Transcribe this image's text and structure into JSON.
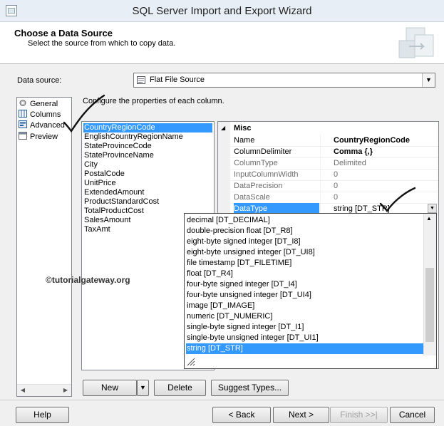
{
  "window": {
    "title": "SQL Server Import and Export Wizard"
  },
  "header": {
    "title": "Choose a Data Source",
    "subtitle": "Select the source from which to copy data."
  },
  "data_source": {
    "label": "Data source:",
    "value": "Flat File Source"
  },
  "nav": {
    "items": [
      {
        "label": "General",
        "icon": "general-icon"
      },
      {
        "label": "Columns",
        "icon": "columns-icon"
      },
      {
        "label": "Advanced",
        "icon": "advanced-icon"
      },
      {
        "label": "Preview",
        "icon": "preview-icon"
      }
    ]
  },
  "hint": "Configure the properties of each column.",
  "columns": [
    "CountryRegionCode",
    "EnglishCountryRegionName",
    "StateProvinceCode",
    "StateProvinceName",
    "City",
    "PostalCode",
    "UnitPrice",
    "ExtendedAmount",
    "ProductStandardCost",
    "TotalProductCost",
    "SalesAmount",
    "TaxAmt"
  ],
  "properties": {
    "category": "Misc",
    "rows": [
      {
        "name": "Name",
        "value": "CountryRegionCode"
      },
      {
        "name": "ColumnDelimiter",
        "value": "Comma {,}"
      },
      {
        "name": "ColumnType",
        "value": "Delimited"
      },
      {
        "name": "InputColumnWidth",
        "value": "0"
      },
      {
        "name": "DataPrecision",
        "value": "0"
      },
      {
        "name": "DataScale",
        "value": "0"
      },
      {
        "name": "DataType",
        "value": "string [DT_STR]"
      }
    ]
  },
  "datatype_options": [
    "decimal [DT_DECIMAL]",
    "double-precision float [DT_R8]",
    "eight-byte signed integer [DT_I8]",
    "eight-byte unsigned integer [DT_UI8]",
    "file timestamp [DT_FILETIME]",
    "float [DT_R4]",
    "four-byte signed integer [DT_I4]",
    "four-byte unsigned integer [DT_UI4]",
    "image [DT_IMAGE]",
    "numeric [DT_NUMERIC]",
    "single-byte signed integer [DT_I1]",
    "single-byte unsigned integer [DT_UI1]",
    "string [DT_STR]"
  ],
  "watermark": "©tutorialgateway.org",
  "buttons": {
    "new": "New",
    "delete": "Delete",
    "suggest": "Suggest Types...",
    "help": "Help",
    "back": "< Back",
    "next": "Next >",
    "finish": "Finish >>|",
    "cancel": "Cancel"
  },
  "colors": {
    "selection": "#3399ff",
    "annotation": "#111111"
  }
}
